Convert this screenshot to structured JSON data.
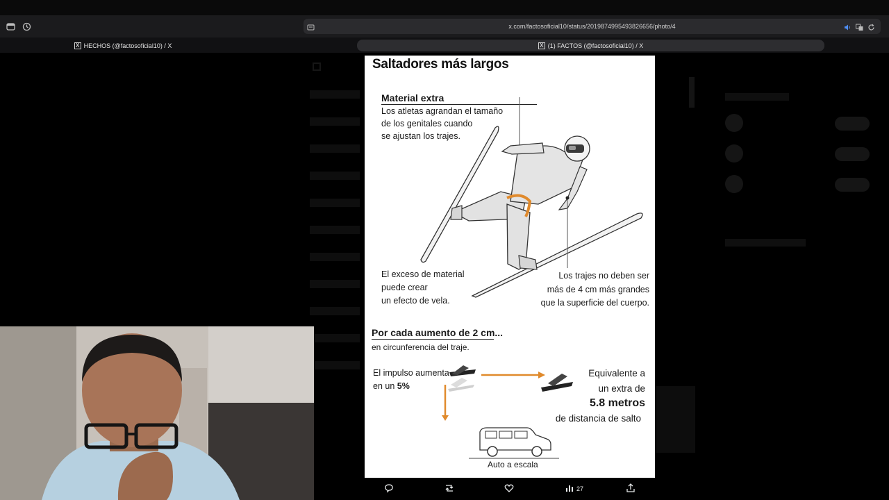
{
  "browser": {
    "url": "x.com/factosoficial10/status/2019874995493826656/photo/4",
    "tabs": [
      {
        "label": "HECHOS (@factosoficial10) / X",
        "active": false
      },
      {
        "label": "(1) FACTOS (@factosoficial10) / X",
        "active": true
      }
    ]
  },
  "infographic": {
    "title": "Saltadores más largos",
    "material_heading": "Material extra",
    "material_lines": [
      "Los atletas agrandan el tamaño",
      "de los genitales cuando",
      "se ajustan los trajes."
    ],
    "exceso_lines": [
      "El exceso de material",
      "puede crear",
      "un efecto de vela."
    ],
    "trajes_lines": [
      "Los trajes no deben ser",
      "más de 4 cm más grandes",
      "que la superficie del cuerpo."
    ],
    "cada_heading": "Por cada aumento de 2 cm...",
    "cada_sub": "en circunferencia del traje.",
    "impulso_line1": "El impulso aumenta",
    "impulso_prefix": "en un",
    "impulso_value": "5%",
    "equivalente_line1": "Equivalente a",
    "equivalente_line2": "un extra de",
    "equivalente_value": "5.8 metros",
    "equivalente_line4": "de distancia de salto",
    "auto_label": "Auto a escala"
  },
  "actions": {
    "views": "27"
  },
  "colors": {
    "accent_orange": "#e08a2c",
    "page_bg": "#000000",
    "panel_bg": "#ffffff"
  }
}
